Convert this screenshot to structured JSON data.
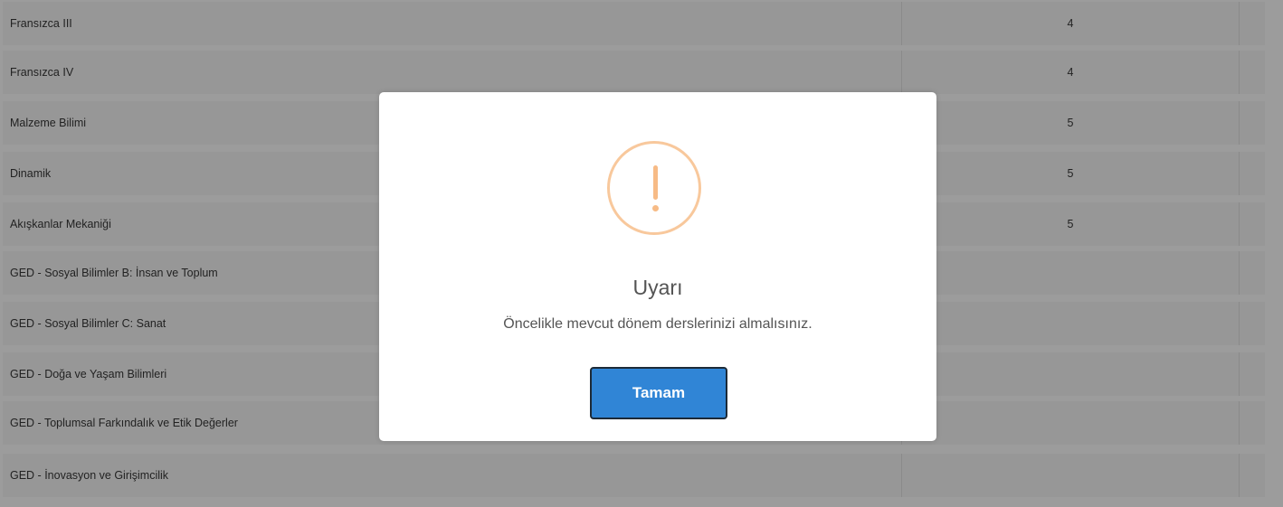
{
  "courses": [
    {
      "name": "Fransızca III",
      "credit": "4"
    },
    {
      "name": "Fransızca IV",
      "credit": "4"
    },
    {
      "name": "Malzeme Bilimi",
      "credit": "5"
    },
    {
      "name": "Dinamik",
      "credit": "5"
    },
    {
      "name": "Akışkanlar Mekaniği",
      "credit": "5"
    },
    {
      "name": "GED - Sosyal Bilimler B: İnsan ve Toplum",
      "credit": ""
    },
    {
      "name": "GED - Sosyal Bilimler C: Sanat",
      "credit": ""
    },
    {
      "name": "GED - Doğa ve Yaşam Bilimleri",
      "credit": ""
    },
    {
      "name": "GED - Toplumsal Farkındalık ve Etik Değerler",
      "credit": ""
    },
    {
      "name": "GED - İnovasyon ve Girişimcilik",
      "credit": ""
    }
  ],
  "dialog": {
    "icon": "warning-exclamation-icon",
    "title": "Uyarı",
    "message": "Öncelikle mevcut dönem derslerinizi almalısınız.",
    "confirm_label": "Tamam"
  },
  "colors": {
    "overlay_background": "#9c9c9c",
    "row_background": "#979797",
    "warning_accent": "#f8c89c",
    "confirm_button": "#3085d6"
  }
}
